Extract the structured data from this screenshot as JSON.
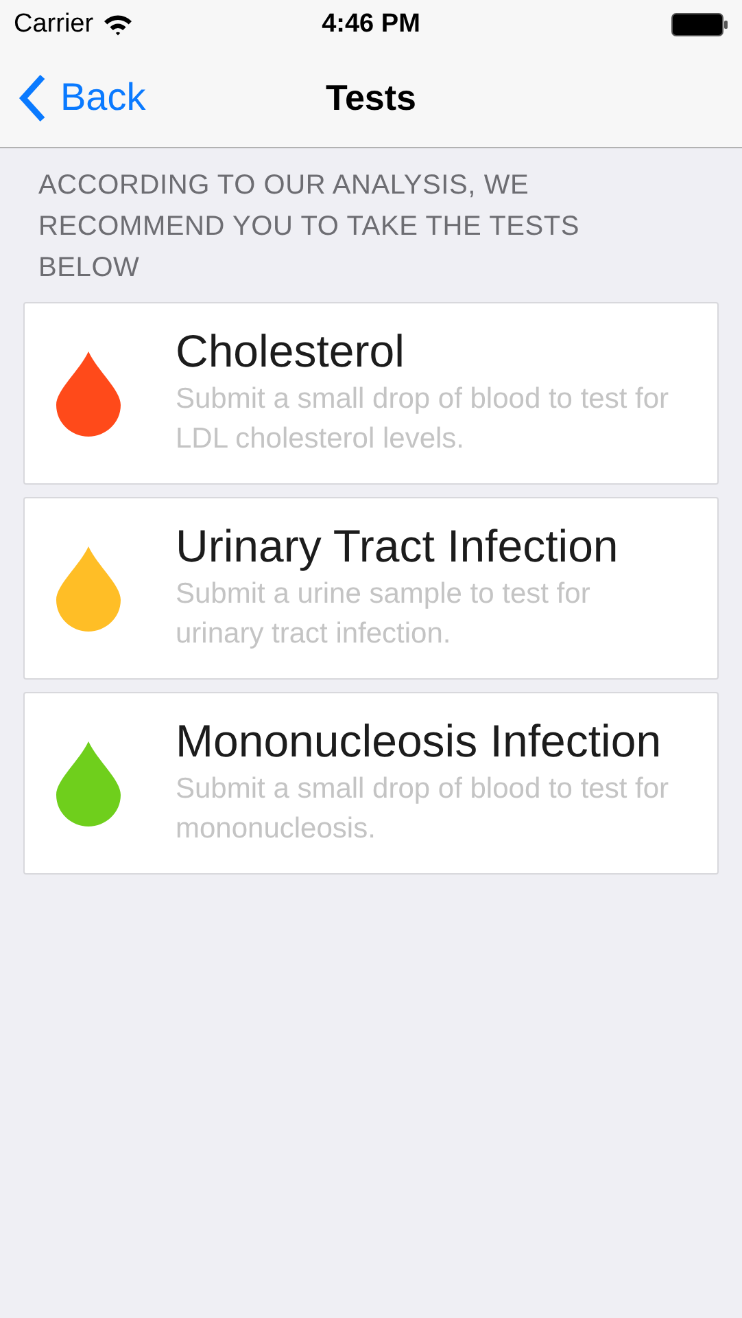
{
  "status_bar": {
    "carrier": "Carrier",
    "time": "4:46 PM"
  },
  "nav": {
    "back": "Back",
    "title": "Tests"
  },
  "section_header": "ACCORDING TO OUR ANALYSIS, WE RECOMMEND YOU TO TAKE THE TESTS BELOW",
  "tests": [
    {
      "title": "Cholesterol",
      "description": "Submit a small drop of blood to test for LDL cholesterol levels.",
      "color": "#ff4a1a"
    },
    {
      "title": "Urinary Tract Infection",
      "description": "Submit a urine sample to test for urinary tract infection.",
      "color": "#ffbe26"
    },
    {
      "title": "Mononucleosis Infection",
      "description": "Submit a small drop of blood to test for mononucleosis.",
      "color": "#6fcf1c"
    }
  ]
}
